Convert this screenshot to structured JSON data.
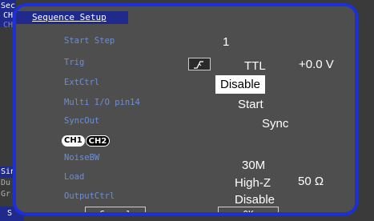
{
  "background": {
    "tab_top_left": "Sec",
    "tab_ch": "CH",
    "tab_ch2": "CH",
    "side_sin": "Sin",
    "side_du": "Du",
    "side_gr": "Gr",
    "side_s": "S"
  },
  "dialog": {
    "title": "Sequence Setup",
    "title_prefix": "S",
    "labels": {
      "start_step": "Start Step",
      "trig": "Trig",
      "extctrl": "ExtCtrl",
      "multi_io": "Multi I/O pin14",
      "syncout": "SyncOut",
      "noisebw": "NoiseBW",
      "load": "Load",
      "outputctrl": "OutputCtrl"
    },
    "channel_tabs": [
      "CH1",
      "CH2"
    ],
    "values": {
      "start_step": "1",
      "trig_mode": "TTL",
      "trig_level": "+0.0 V",
      "extctrl": "Disable",
      "multi_io": "Start",
      "syncout": "Sync",
      "noisebw": "30M",
      "load_mode": "High-Z",
      "load_value": "50 Ω",
      "outputctrl": "Disable"
    },
    "buttons": {
      "cancel": "Cancel",
      "ok": "OK"
    },
    "colors": {
      "frame": "#1d2fd6",
      "panel": "#4e4e4e",
      "label": "#6d8fd6",
      "selected_bg": "#ffffff"
    }
  }
}
